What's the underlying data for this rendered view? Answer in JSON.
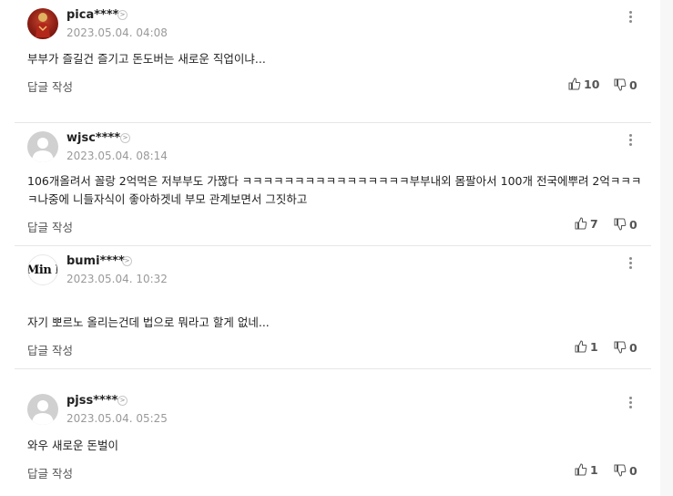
{
  "comments": [
    {
      "username": "pica****",
      "date": "2023.05.04. 04:08",
      "text": "부부가 즐길건 즐기고 돈도버는 새로운 직업이냐...",
      "reply_label": "답글 작성",
      "likes": "10",
      "dislikes": "0",
      "avatar": "red-figure-avatar"
    },
    {
      "username": "wjsc****",
      "date": "2023.05.04. 08:14",
      "text": "106개올려서 꼴랑 2억먹은 저부부도 가짢다 ㅋㅋㅋㅋㅋㅋㅋㅋㅋㅋㅋㅋㅋㅋㅋㅋ부부내외 몸팔아서 100개 전국에뿌려 2억ㅋㅋㅋㅋ나중에 니들자식이 좋아하겟네 부모 관계보면서 그짓하고",
      "reply_label": "답글 작성",
      "likes": "7",
      "dislikes": "0",
      "avatar": "default-avatar"
    },
    {
      "username": "bumi****",
      "date": "2023.05.04. 10:32",
      "text": "자기 뽀르노 올리는건데 법으로 뭐라고 할게 없네...",
      "reply_label": "답글 작성",
      "likes": "1",
      "dislikes": "0",
      "avatar": "text-avatar",
      "avatar_text": "Min In"
    },
    {
      "username": "pjss****",
      "date": "2023.05.04. 05:25",
      "text": "와우 새로운 돈벌이",
      "reply_label": "답글 작성",
      "likes": "1",
      "dislikes": "0",
      "avatar": "default-avatar"
    }
  ]
}
